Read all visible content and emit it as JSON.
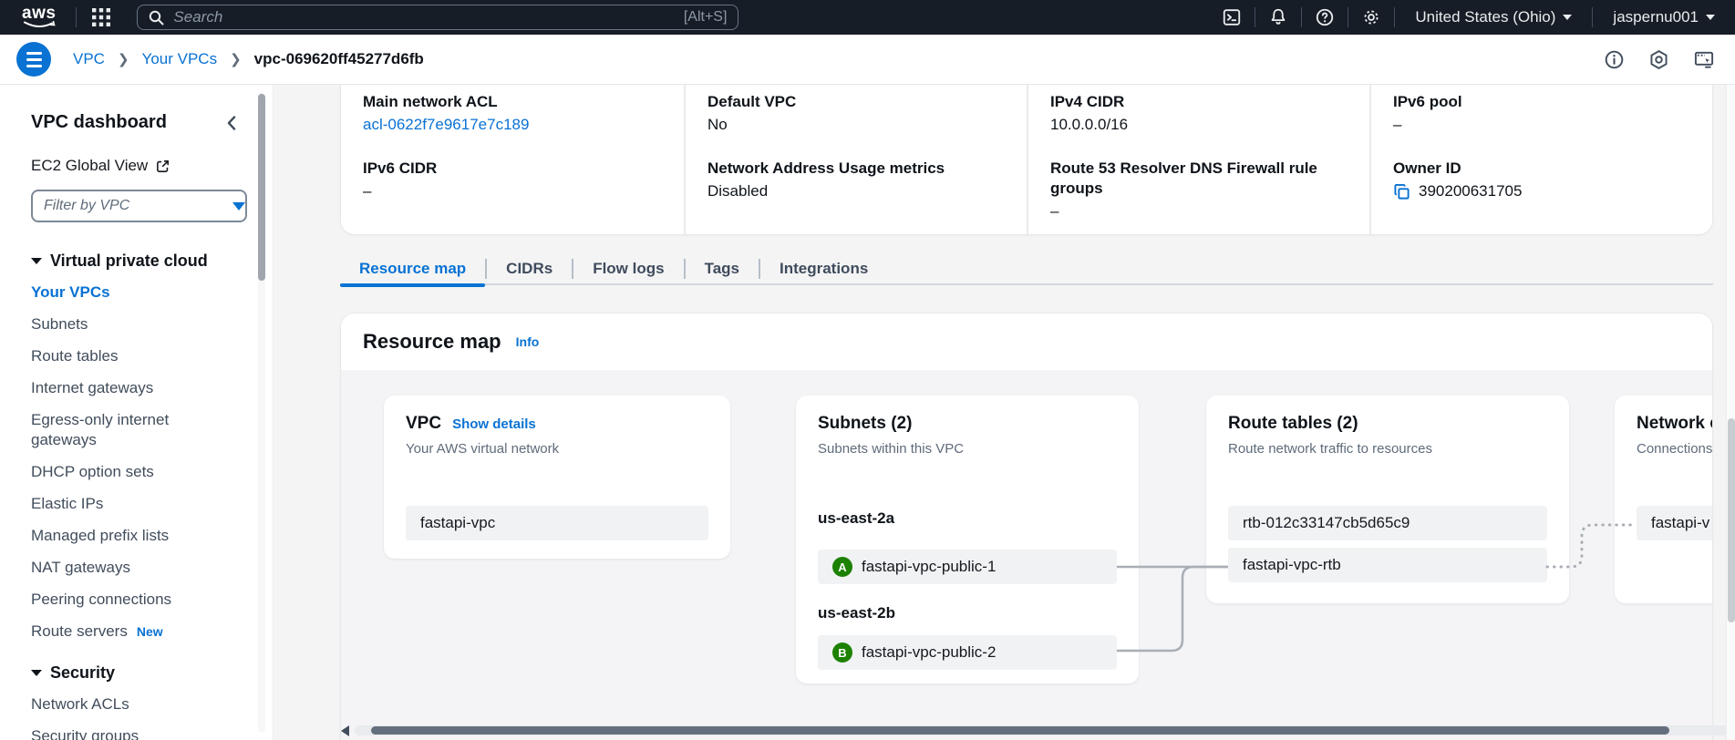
{
  "colors": {
    "accent_blue": "#0972d3",
    "badge_green": "#1d8102",
    "topbar_bg": "#161d26"
  },
  "topbar": {
    "logo": "aws",
    "search_placeholder": "Search",
    "search_shortcut": "[Alt+S]",
    "region": "United States (Ohio)",
    "username": "jaspernu001",
    "icons": [
      "apps-grid-icon",
      "cloudshell-icon",
      "notifications-bell-icon",
      "help-icon",
      "settings-gear-icon"
    ]
  },
  "breadcrumb": {
    "links": [
      "VPC",
      "Your VPCs"
    ],
    "current": "vpc-069620ff45277d6fb",
    "icons": [
      "info-icon",
      "assistant-hexagon-icon",
      "console-monitor-icon"
    ]
  },
  "sidebar": {
    "title": "VPC dashboard",
    "global_view_label": "EC2 Global View",
    "filter_placeholder": "Filter by VPC",
    "sections": [
      {
        "label": "Virtual private cloud",
        "items": [
          {
            "label": "Your VPCs",
            "active": true
          },
          {
            "label": "Subnets"
          },
          {
            "label": "Route tables"
          },
          {
            "label": "Internet gateways"
          },
          {
            "label": "Egress-only internet gateways"
          },
          {
            "label": "DHCP option sets"
          },
          {
            "label": "Elastic IPs"
          },
          {
            "label": "Managed prefix lists"
          },
          {
            "label": "NAT gateways"
          },
          {
            "label": "Peering connections"
          },
          {
            "label": "Route servers",
            "badge": "New"
          }
        ]
      },
      {
        "label": "Security",
        "items": [
          {
            "label": "Network ACLs"
          },
          {
            "label": "Security groups"
          }
        ]
      }
    ]
  },
  "details": {
    "columns": [
      {
        "rows": [
          {
            "label": "Main network ACL",
            "value": "acl-0622f7e9617e7c189"
          },
          {
            "label": "IPv6 CIDR",
            "value": "–"
          }
        ]
      },
      {
        "rows": [
          {
            "label": "Default VPC",
            "value": "No"
          },
          {
            "label": "Network Address Usage metrics",
            "value": "Disabled"
          }
        ]
      },
      {
        "rows": [
          {
            "label": "IPv4 CIDR",
            "value": "10.0.0.0/16"
          },
          {
            "label": "Route 53 Resolver DNS Firewall rule groups",
            "value": "–"
          }
        ]
      },
      {
        "rows": [
          {
            "label": "IPv6 pool",
            "value": "–"
          },
          {
            "label": "Owner ID",
            "value": "390200631705"
          }
        ]
      }
    ]
  },
  "tabs": {
    "items": [
      {
        "label": "Resource map",
        "active": true
      },
      {
        "label": "CIDRs"
      },
      {
        "label": "Flow logs"
      },
      {
        "label": "Tags"
      },
      {
        "label": "Integrations"
      }
    ]
  },
  "resource_map": {
    "title": "Resource map",
    "info_label": "Info",
    "cards": [
      {
        "title": "VPC",
        "action": "Show details",
        "subtitle": "Your AWS virtual network",
        "rows": [
          {
            "text": "fastapi-vpc"
          }
        ]
      },
      {
        "title": "Subnets (2)",
        "subtitle": "Subnets within this VPC",
        "groups": [
          {
            "label": "us-east-2a",
            "rows": [
              {
                "badge": "A",
                "text": "fastapi-vpc-public-1"
              }
            ]
          },
          {
            "label": "us-east-2b",
            "rows": [
              {
                "badge": "B",
                "text": "fastapi-vpc-public-2"
              }
            ]
          }
        ]
      },
      {
        "title": "Route tables (2)",
        "subtitle": "Route network traffic to resources",
        "rows": [
          {
            "text": "rtb-012c33147cb5d65c9"
          },
          {
            "text": "fastapi-vpc-rtb"
          }
        ]
      },
      {
        "title": "Network connections",
        "subtitle": "Connections to other networks",
        "rows": [
          {
            "text": "fastapi-v"
          }
        ]
      }
    ]
  }
}
